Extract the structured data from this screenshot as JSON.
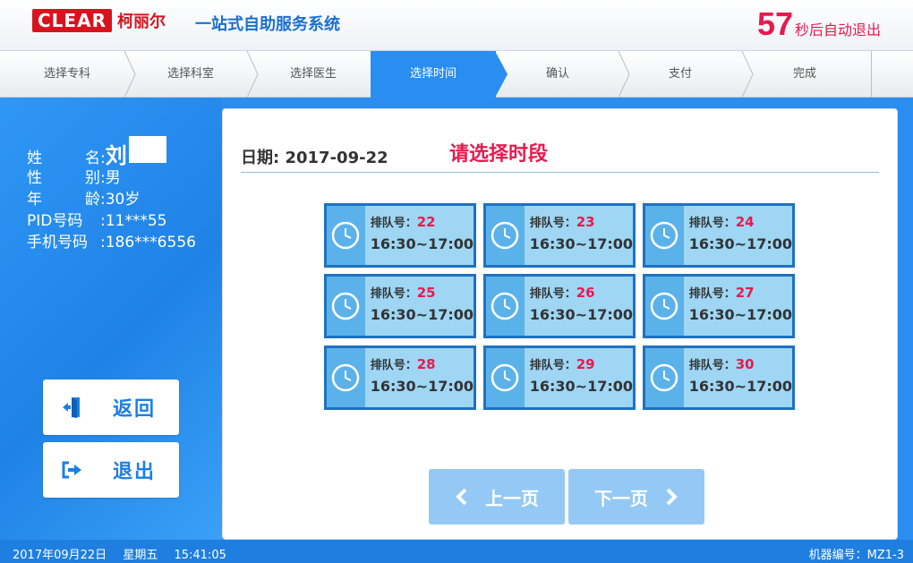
{
  "header": {
    "logo_en": "CLEAR",
    "logo_cn": "柯丽尔",
    "system_title": "一站式自助服务系统",
    "countdown_value": "57",
    "countdown_text": "秒后自动退出"
  },
  "steps": [
    {
      "label": "选择专科",
      "active": false
    },
    {
      "label": "选择科室",
      "active": false
    },
    {
      "label": "选择医生",
      "active": false
    },
    {
      "label": "选择时间",
      "active": true
    },
    {
      "label": "确认",
      "active": false
    },
    {
      "label": "支付",
      "active": false
    },
    {
      "label": "完成",
      "active": false
    }
  ],
  "patient": {
    "name_label_chars": [
      "姓",
      "名"
    ],
    "name_value": "刘",
    "gender_label_chars": [
      "性",
      "别"
    ],
    "gender_value": "男",
    "age_label_chars": [
      "年",
      "龄"
    ],
    "age_value": "30岁",
    "pid_label": "PID号码",
    "pid_value": "11***55",
    "phone_label": "手机号码",
    "phone_value": "186***6556",
    "colon": ":"
  },
  "side_buttons": {
    "back_label": "返回",
    "exit_label": "退出"
  },
  "main": {
    "date_label": "日期:",
    "date_value": "2017-09-22",
    "prompt": "请选择时段",
    "queue_label": "排队号：",
    "slots": [
      {
        "num": "22",
        "time": "16:30~17:00"
      },
      {
        "num": "23",
        "time": "16:30~17:00"
      },
      {
        "num": "24",
        "time": "16:30~17:00"
      },
      {
        "num": "25",
        "time": "16:30~17:00"
      },
      {
        "num": "26",
        "time": "16:30~17:00"
      },
      {
        "num": "27",
        "time": "16:30~17:00"
      },
      {
        "num": "28",
        "time": "16:30~17:00"
      },
      {
        "num": "29",
        "time": "16:30~17:00"
      },
      {
        "num": "30",
        "time": "16:30~17:00"
      }
    ],
    "prev_label": "上一页",
    "next_label": "下一页"
  },
  "footer": {
    "date": "2017年09月22日",
    "weekday": "星期五",
    "time": "15:41:05",
    "machine": "机器编号：MZ1-3"
  },
  "colors": {
    "accent_blue": "#2a8df0",
    "highlight_red": "#e8194d",
    "slot_border": "#1e72bf",
    "slot_fill": "#9ed6f4"
  },
  "icons": [
    "clock-icon",
    "exit-door-icon",
    "logout-arrow-icon",
    "chevron-left-icon",
    "chevron-right-icon",
    "step-chevron-icon"
  ]
}
